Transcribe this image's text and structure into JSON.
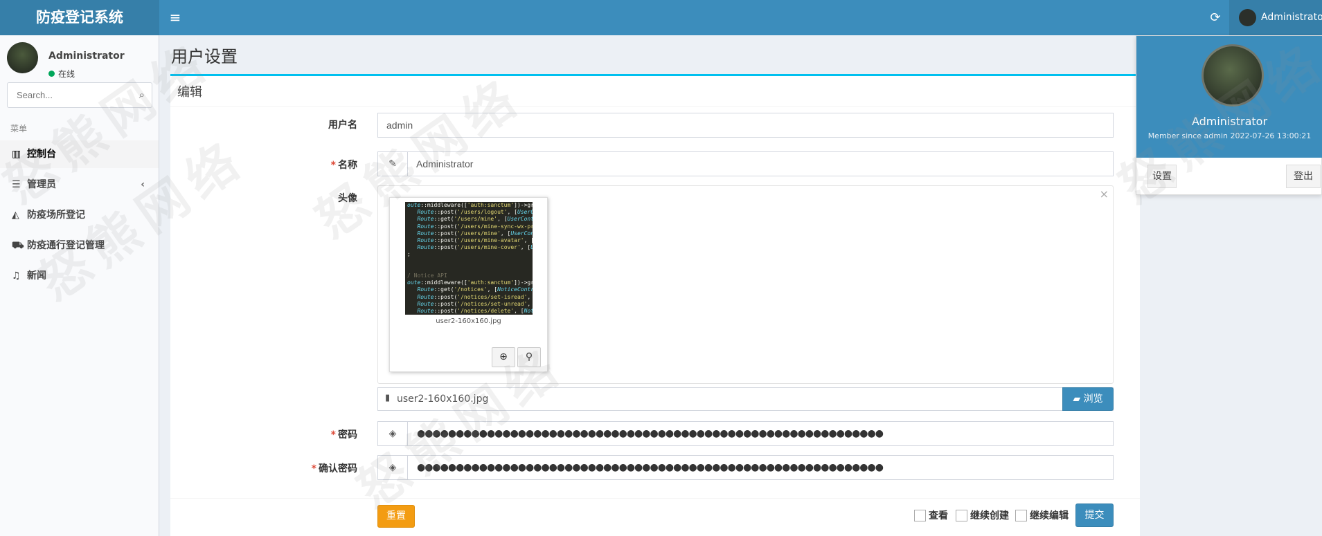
{
  "app": {
    "brand": "防疫登记系统"
  },
  "topbar": {
    "user_name": "Administrator"
  },
  "sidebar": {
    "user_name": "Administrator",
    "status": "在线",
    "search_placeholder": "Search...",
    "menu_header": "菜单",
    "items": [
      {
        "label": "控制台",
        "icon": "bar-chart-icon",
        "active": true
      },
      {
        "label": "管理员",
        "icon": "list-icon",
        "has_children": true
      },
      {
        "label": "防疫场所登记",
        "icon": "area-chart-icon"
      },
      {
        "label": "防疫通行登记管理",
        "icon": "car-icon"
      },
      {
        "label": "新闻",
        "icon": "bell-icon"
      }
    ]
  },
  "page": {
    "title": "用户设置",
    "box_title": "编辑"
  },
  "form": {
    "username_label": "用户名",
    "username_value": "admin",
    "name_label": "名称",
    "name_value": "Administrator",
    "avatar_label": "头像",
    "avatar_file": "user2-160x160.jpg",
    "browse_label": "浏览",
    "password_label": "密码",
    "password_value": "●●●●●●●●●●●●●●●●●●●●●●●●●●●●●●●●●●●●●●●●●●●●●●●●●●●●●●●●●●●●",
    "confirm_label": "确认密码",
    "confirm_value": "●●●●●●●●●●●●●●●●●●●●●●●●●●●●●●●●●●●●●●●●●●●●●●●●●●●●●●●●●●●●",
    "reset_label": "重置",
    "check_view": "查看",
    "check_continue_create": "继续创建",
    "check_continue_edit": "继续编辑",
    "submit_label": "提交"
  },
  "dropdown": {
    "name": "Administrator",
    "since": "Member since admin 2022-07-26 13:00:21",
    "settings_label": "设置",
    "logout_label": "登出"
  },
  "watermark": "怒熊网络",
  "colors": {
    "primary": "#3c8dbc",
    "accent": "#00c0ef",
    "warning": "#f39c12",
    "required": "#dd4b39"
  }
}
